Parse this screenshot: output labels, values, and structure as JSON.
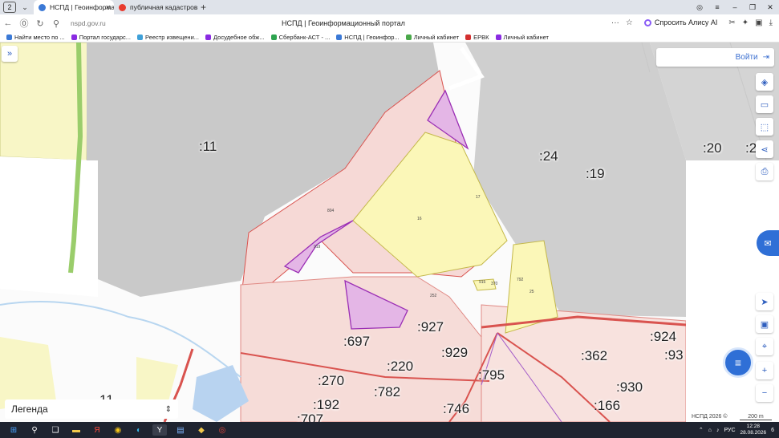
{
  "browser": {
    "tab_count": "2",
    "tabs": [
      {
        "title": "НСПД | Геоинформац",
        "active": true
      },
      {
        "title": "публичная кадастровая",
        "active": false
      }
    ],
    "url": "nspd.gov.ru",
    "page_title": "НСПД | Геоинформационный портал",
    "alice_label": "Спросить Алису AI",
    "bookmarks": [
      "Найти место по ...",
      "Портал государс...",
      "Реестр извещени...",
      "Досудебное обж...",
      "Сбербанк-АСТ - ...",
      "НСПД | Геоинфор...",
      "Личный кабинет",
      "ЕРВК",
      "Личный кабинет"
    ]
  },
  "map": {
    "login_label": "Войти",
    "legend_label": "Легенда",
    "copyright": "НСПД 2026 ©",
    "scale": "200 m",
    "quarter_labels": [
      ":11",
      ":24",
      ":19",
      ":20",
      ":2",
      ":697",
      ":927",
      ":220",
      ":929",
      ":795",
      ":362",
      ":924",
      ":93",
      ":270",
      ":782",
      ":930",
      ":192",
      ":746",
      ":166",
      ":707",
      "11"
    ],
    "parcel_labels": [
      "804",
      "919",
      "16",
      "17",
      "915",
      "370",
      "792",
      "25",
      "252"
    ]
  },
  "taskbar": {
    "tray_lang": "РУС",
    "time": "12:28",
    "date": "28.08.2026",
    "notif_count": "6"
  },
  "colors": {
    "accent": "#2f6fd6",
    "parcel_red": "#d9534f",
    "parcel_fill_pink": "#f6d9d6",
    "parcel_fill_yellow": "#fbf7b8",
    "parcel_purple": "#9b2fb5",
    "forest_gray": "#c9c9c9"
  }
}
